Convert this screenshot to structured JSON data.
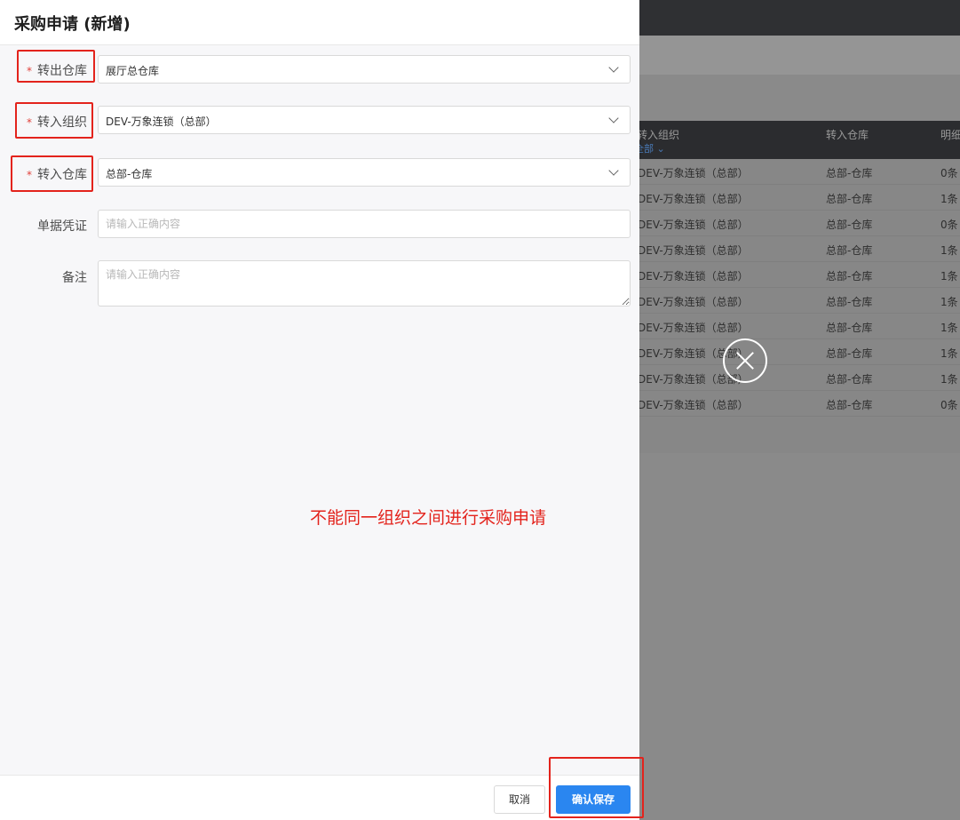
{
  "drawer": {
    "title": "采购申请 (新增)"
  },
  "form": {
    "required_mark": "*",
    "from_warehouse": {
      "label": "转出仓库",
      "value": "展厅总仓库"
    },
    "to_org": {
      "label": "转入组织",
      "value": "DEV-万象连锁（总部）"
    },
    "to_warehouse": {
      "label": "转入仓库",
      "value": "总部-仓库"
    },
    "voucher": {
      "label": "单据凭证",
      "placeholder": "请输入正确内容"
    },
    "remark": {
      "label": "备注",
      "placeholder": "请输入正确内容"
    }
  },
  "annotation": {
    "message": "不能同一组织之间进行采购申请",
    "color": "#e3231c"
  },
  "footer": {
    "cancel_label": "取消",
    "save_label": "确认保存"
  },
  "background_table": {
    "headers": {
      "to_org": "转入组织",
      "to_org_filter": "全部",
      "to_warehouse": "转入仓库",
      "details": "明细"
    },
    "rows": [
      {
        "org": "DEV-万象连锁（总部）",
        "warehouse": "总部-仓库",
        "count": "0条"
      },
      {
        "org": "DEV-万象连锁（总部）",
        "warehouse": "总部-仓库",
        "count": "1条"
      },
      {
        "org": "DEV-万象连锁（总部）",
        "warehouse": "总部-仓库",
        "count": "0条"
      },
      {
        "org": "DEV-万象连锁（总部）",
        "warehouse": "总部-仓库",
        "count": "1条"
      },
      {
        "org": "DEV-万象连锁（总部）",
        "warehouse": "总部-仓库",
        "count": "1条"
      },
      {
        "org": "DEV-万象连锁（总部）",
        "warehouse": "总部-仓库",
        "count": "1条"
      },
      {
        "org": "DEV-万象连锁（总部）",
        "warehouse": "总部-仓库",
        "count": "1条"
      },
      {
        "org": "DEV-万象连锁（总部）",
        "warehouse": "总部-仓库",
        "count": "1条"
      },
      {
        "org": "DEV-万象连锁（总部）",
        "warehouse": "总部-仓库",
        "count": "1条"
      },
      {
        "org": "DEV-万象连锁（总部）",
        "warehouse": "总部-仓库",
        "count": "0条"
      }
    ]
  },
  "colors": {
    "primary": "#2a86f0",
    "required": "#e0413a"
  }
}
